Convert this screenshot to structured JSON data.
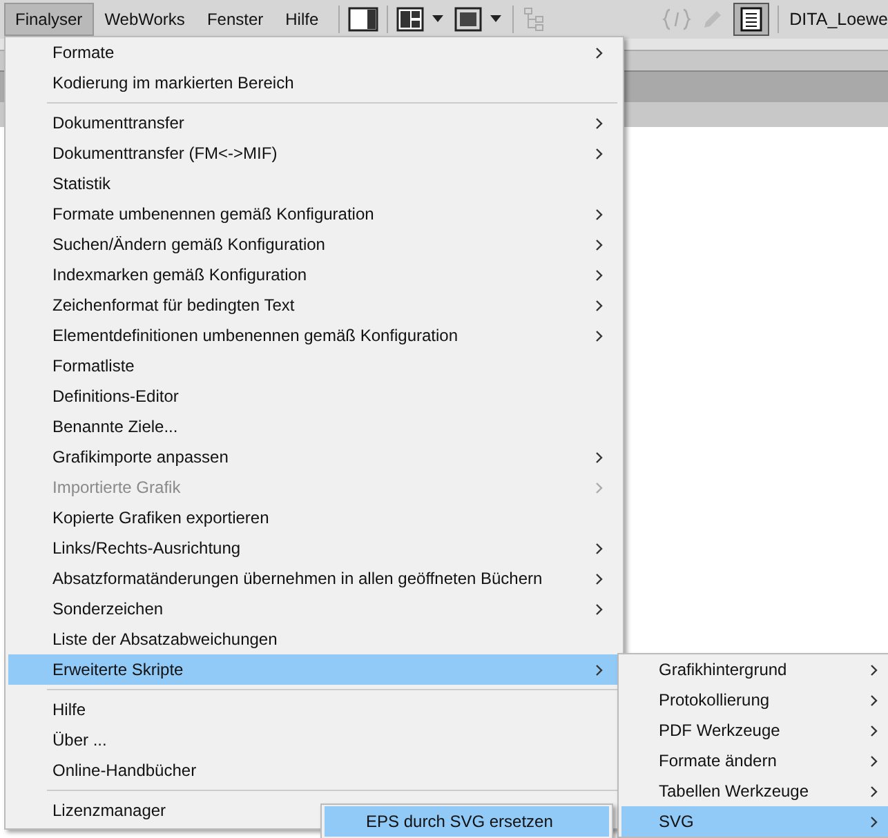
{
  "menubar": {
    "menus": [
      {
        "label": "Finalyser",
        "selected": true
      },
      {
        "label": "WebWorks",
        "selected": false
      },
      {
        "label": "Fenster",
        "selected": false
      },
      {
        "label": "Hilfe",
        "selected": false
      }
    ],
    "document_title": "DITA_Loewe"
  },
  "menu": {
    "groups": [
      [
        {
          "label": "Formate",
          "submenu": true,
          "disabled": false,
          "selected": false
        },
        {
          "label": "Kodierung im markierten Bereich",
          "submenu": false,
          "disabled": false,
          "selected": false
        }
      ],
      [
        {
          "label": "Dokumenttransfer",
          "submenu": true,
          "disabled": false,
          "selected": false
        },
        {
          "label": "Dokumenttransfer (FM<->MIF)",
          "submenu": true,
          "disabled": false,
          "selected": false
        },
        {
          "label": "Statistik",
          "submenu": false,
          "disabled": false,
          "selected": false
        },
        {
          "label": "Formate umbenennen gemäß Konfiguration",
          "submenu": true,
          "disabled": false,
          "selected": false
        },
        {
          "label": "Suchen/Ändern gemäß Konfiguration",
          "submenu": true,
          "disabled": false,
          "selected": false
        },
        {
          "label": "Indexmarken gemäß Konfiguration",
          "submenu": true,
          "disabled": false,
          "selected": false
        },
        {
          "label": "Zeichenformat für bedingten Text",
          "submenu": true,
          "disabled": false,
          "selected": false
        },
        {
          "label": "Elementdefinitionen umbenennen gemäß Konfiguration",
          "submenu": true,
          "disabled": false,
          "selected": false
        },
        {
          "label": "Formatliste",
          "submenu": false,
          "disabled": false,
          "selected": false
        },
        {
          "label": "Definitions-Editor",
          "submenu": false,
          "disabled": false,
          "selected": false
        },
        {
          "label": "Benannte Ziele...",
          "submenu": false,
          "disabled": false,
          "selected": false
        },
        {
          "label": "Grafikimporte anpassen",
          "submenu": true,
          "disabled": false,
          "selected": false
        },
        {
          "label": "Importierte Grafik",
          "submenu": true,
          "disabled": true,
          "selected": false
        },
        {
          "label": "Kopierte Grafiken exportieren",
          "submenu": false,
          "disabled": false,
          "selected": false
        },
        {
          "label": "Links/Rechts-Ausrichtung",
          "submenu": true,
          "disabled": false,
          "selected": false
        },
        {
          "label": "Absatzformatänderungen übernehmen in allen geöffneten Büchern",
          "submenu": true,
          "disabled": false,
          "selected": false
        },
        {
          "label": "Sonderzeichen",
          "submenu": true,
          "disabled": false,
          "selected": false
        },
        {
          "label": "Liste der Absatzabweichungen",
          "submenu": false,
          "disabled": false,
          "selected": false
        },
        {
          "label": "Erweiterte Skripte",
          "submenu": true,
          "disabled": false,
          "selected": true
        }
      ],
      [
        {
          "label": "Hilfe",
          "submenu": false,
          "disabled": false,
          "selected": false
        },
        {
          "label": "Über ...",
          "submenu": false,
          "disabled": false,
          "selected": false
        },
        {
          "label": "Online-Handbücher",
          "submenu": false,
          "disabled": false,
          "selected": false
        }
      ],
      [
        {
          "label": "Lizenzmanager",
          "submenu": false,
          "disabled": false,
          "selected": false
        }
      ]
    ]
  },
  "submenu": {
    "items": [
      {
        "label": "Grafikhintergrund",
        "submenu": true,
        "selected": false
      },
      {
        "label": "Protokollierung",
        "submenu": true,
        "selected": false
      },
      {
        "label": "PDF Werkzeuge",
        "submenu": true,
        "selected": false
      },
      {
        "label": "Formate ändern",
        "submenu": true,
        "selected": false
      },
      {
        "label": "Tabellen Werkzeuge",
        "submenu": true,
        "selected": false
      },
      {
        "label": "SVG",
        "submenu": true,
        "selected": true
      }
    ]
  },
  "submenu_2": {
    "items": [
      {
        "label": "EPS durch SVG ersetzen",
        "selected": true
      }
    ]
  }
}
